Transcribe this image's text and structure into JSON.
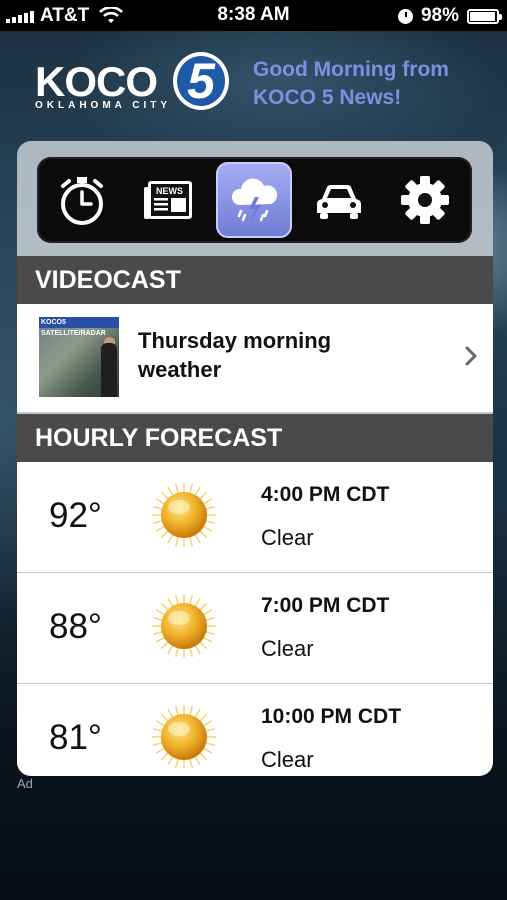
{
  "status_bar": {
    "carrier": "AT&T",
    "time": "8:38 AM",
    "battery": "98%",
    "battery_level": 0.98
  },
  "header": {
    "logo_text": "KOCO",
    "logo_number": "5",
    "logo_subtext": "OKLAHOMA CITY",
    "greeting": "Good Morning from KOCO 5 News!"
  },
  "toolbar": {
    "items": [
      {
        "name": "timer",
        "icon": "stopwatch-icon",
        "active": false
      },
      {
        "name": "news",
        "icon": "newspaper-icon",
        "active": false
      },
      {
        "name": "weather",
        "icon": "storm-cloud-icon",
        "active": true
      },
      {
        "name": "traffic",
        "icon": "car-icon",
        "active": false
      },
      {
        "name": "settings",
        "icon": "gear-icon",
        "active": false
      }
    ],
    "news_icon_text": "NEWS"
  },
  "videocast": {
    "header": "VIDEOCAST",
    "thumb_banner": "KOCO5 SATELLITE/RADAR",
    "title": "Thursday morning weather"
  },
  "hourly": {
    "header": "HOURLY FORECAST",
    "rows": [
      {
        "temp": "92°",
        "time": "4:00 PM CDT",
        "condition": "Clear",
        "icon": "sun-icon"
      },
      {
        "temp": "88°",
        "time": "7:00 PM CDT",
        "condition": "Clear",
        "icon": "sun-icon"
      },
      {
        "temp": "81°",
        "time": "10:00 PM CDT",
        "condition": "Clear",
        "icon": "sun-icon"
      }
    ]
  },
  "footer": {
    "ad_label": "Ad"
  },
  "colors": {
    "accent": "#7e8fe0",
    "section_header_bg": "#4a4a4a",
    "active_tab": "#8f99e6"
  }
}
